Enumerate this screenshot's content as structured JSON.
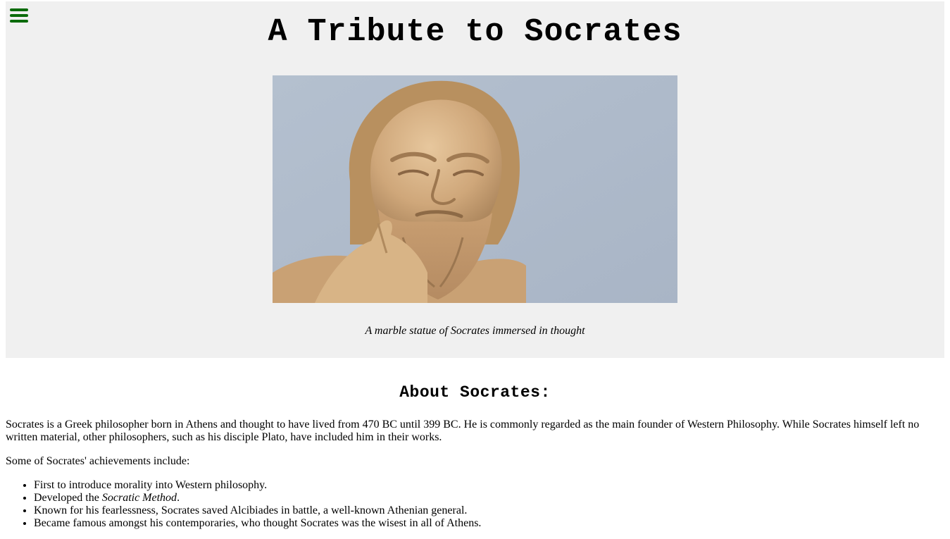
{
  "header": {
    "title": "A Tribute to Socrates",
    "menu_icon": "hamburger-menu-icon",
    "menu_color": "#0b6b0b",
    "background": "#f0f0f0"
  },
  "image": {
    "subject": "marble statue of Socrates",
    "caption": "A marble statue of Socrates immersed in thought"
  },
  "about": {
    "heading": "About Socrates:",
    "paragraph1": "Socrates is a Greek philosopher born in Athens and thought to have lived from 470 BC until 399 BC. He is commonly regarded as the main founder of Western Philosophy. While Socrates himself left no written material, other philosophers, such as his disciple Plato, have included him in their works.",
    "paragraph2": "Some of Socrates' achievements include:",
    "achievements": [
      {
        "text": "First to introduce morality into Western philosophy."
      },
      {
        "prefix": "Developed the ",
        "emphasis": "Socratic Method",
        "suffix": "."
      },
      {
        "text": "Known for his fearlessness, Socrates saved Alcibiades in battle, a well-known Athenian general."
      },
      {
        "text": "Became famous amongst his contemporaries, who thought Socrates was the wisest in all of Athens."
      }
    ]
  }
}
